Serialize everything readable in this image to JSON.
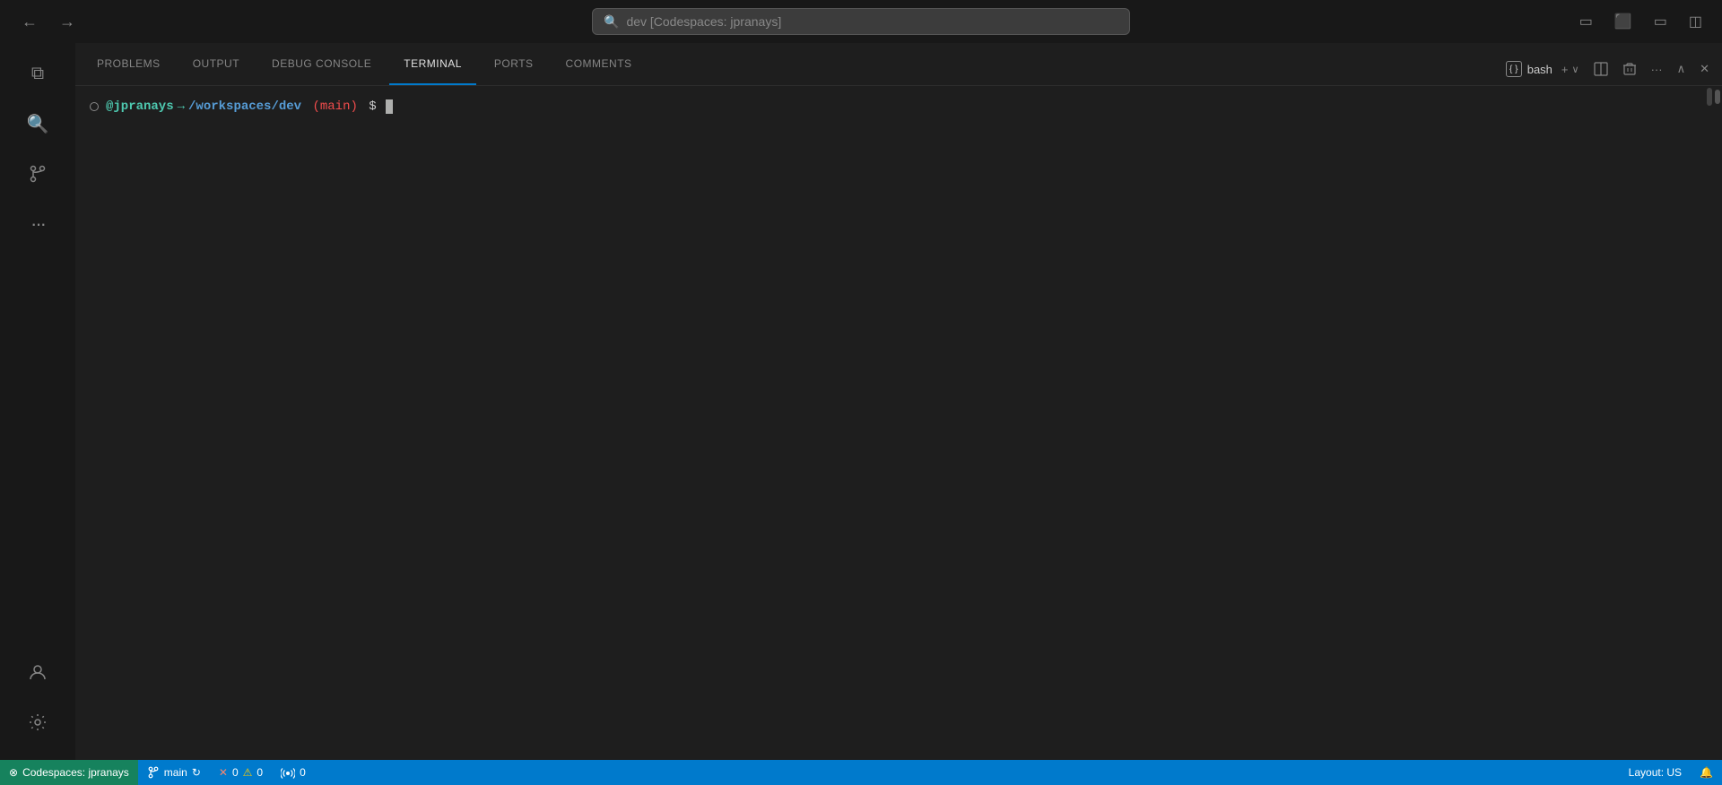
{
  "titlebar": {
    "back_label": "←",
    "forward_label": "→",
    "search_placeholder": "dev [Codespaces: jpranays]",
    "search_icon": "🔍",
    "layout_icon1": "⬛",
    "layout_icon2": "⬜",
    "layout_icon3": "⬛⬛",
    "layout_icon4": "◻◻"
  },
  "activity_bar": {
    "items": [
      {
        "id": "explorer",
        "icon": "⧉",
        "label": "Explorer"
      },
      {
        "id": "search",
        "icon": "🔍",
        "label": "Search"
      },
      {
        "id": "source-control",
        "icon": "⎇",
        "label": "Source Control"
      },
      {
        "id": "extensions",
        "icon": "⋯",
        "label": "Extensions"
      }
    ],
    "bottom_items": [
      {
        "id": "account",
        "icon": "👤",
        "label": "Account"
      },
      {
        "id": "settings",
        "icon": "⚙",
        "label": "Settings"
      }
    ]
  },
  "panel": {
    "tabs": [
      {
        "id": "problems",
        "label": "PROBLEMS"
      },
      {
        "id": "output",
        "label": "OUTPUT"
      },
      {
        "id": "debug-console",
        "label": "DEBUG CONSOLE"
      },
      {
        "id": "terminal",
        "label": "TERMINAL",
        "active": true
      },
      {
        "id": "ports",
        "label": "PORTS"
      },
      {
        "id": "comments",
        "label": "COMMENTS"
      }
    ],
    "bash_label": "bash",
    "bash_icon_text": "{ }",
    "add_terminal_label": "+",
    "split_terminal_label": "⊟",
    "kill_terminal_label": "🗑",
    "more_actions_label": "···",
    "collapse_label": "∨",
    "close_label": "✕"
  },
  "terminal": {
    "dot_symbol": "○",
    "user": "@jpranays",
    "arrow": "→",
    "path": "/workspaces/dev",
    "branch_open": "(",
    "branch": "main",
    "branch_close": ")",
    "prompt": "$"
  },
  "statusbar": {
    "codespace_icon": "⊗",
    "codespace_label": "Codespaces: jpranays",
    "branch_icon": "⎇",
    "branch_label": "main",
    "sync_icon": "↻",
    "error_icon": "✕",
    "error_count": "0",
    "warning_icon": "⚠",
    "warning_count": "0",
    "broadcast_icon": "((•))",
    "broadcast_count": "0",
    "layout_label": "Layout: US",
    "notification_icon": "🔔"
  }
}
